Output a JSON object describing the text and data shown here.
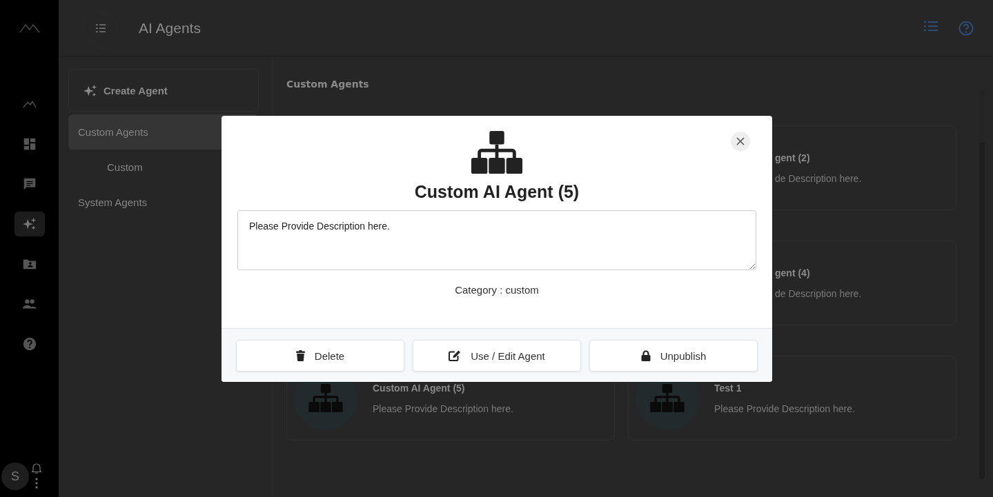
{
  "rail": {
    "items": [
      {
        "kind": "peaks",
        "selected": false
      },
      {
        "kind": "dashboard",
        "selected": false
      },
      {
        "kind": "chat",
        "selected": false
      },
      {
        "kind": "sparkles",
        "selected": true
      },
      {
        "kind": "folder",
        "selected": false
      },
      {
        "kind": "people",
        "selected": false
      },
      {
        "kind": "help",
        "selected": false
      }
    ],
    "avatar": "S"
  },
  "header": {
    "title": "AI Agents"
  },
  "sidebar": {
    "create_button": "Create Agent",
    "items": [
      {
        "label": "Custom Agents",
        "selected": true,
        "children": [
          {
            "label": "Custom",
            "selected": false
          }
        ]
      },
      {
        "label": "System Agents",
        "selected": false
      }
    ]
  },
  "main": {
    "heading": "Custom Agents",
    "card_rows": [
      {
        "right": {
          "kind": "partial",
          "title": "gent (2)",
          "description": "de Description here."
        }
      },
      {
        "right": {
          "kind": "partial",
          "title": "gent (4)",
          "description": "de Description here."
        }
      },
      {
        "left": {
          "kind": "full",
          "title": "Custom AI Agent (5)",
          "description": "Please Provide Description here."
        },
        "right": {
          "kind": "full",
          "title": "Test 1",
          "description": "Please Provide Description here."
        }
      }
    ]
  },
  "modal": {
    "title": "Custom AI Agent (5)",
    "description": "Please Provide Description here.",
    "category": "Category : custom",
    "buttons": [
      {
        "kind": "delete",
        "label": "Delete"
      },
      {
        "kind": "edit",
        "label": "Use / Edit Agent"
      },
      {
        "kind": "lock",
        "label": "Unpublish"
      }
    ]
  }
}
